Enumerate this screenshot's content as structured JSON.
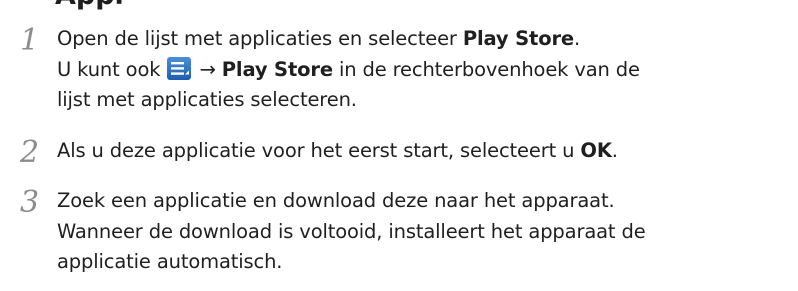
{
  "heading_fragment": "Appl",
  "steps": [
    {
      "num": "1",
      "l1_a": "Open de lijst met applicaties en selecteer ",
      "l1_b": "Play Store",
      "l1_c": ".",
      "l2_a": "U kunt ook ",
      "l2_arrow": "→",
      "l2_b": "Play Store",
      "l2_c": " in de rechterbovenhoek van de",
      "l3": "lijst met applicaties selecteren."
    },
    {
      "num": "2",
      "l1_a": "Als u deze applicatie voor het eerst start, selecteert u ",
      "l1_b": "OK",
      "l1_c": "."
    },
    {
      "num": "3",
      "l1": "Zoek een applicatie en download deze naar het apparaat.",
      "l2": "Wanneer de download is voltooid, installeert het apparaat de",
      "l3": "applicatie automatisch."
    }
  ],
  "icons": {
    "menu_icon": "menu-icon",
    "menu_icon_color": "#2f7bd0"
  }
}
